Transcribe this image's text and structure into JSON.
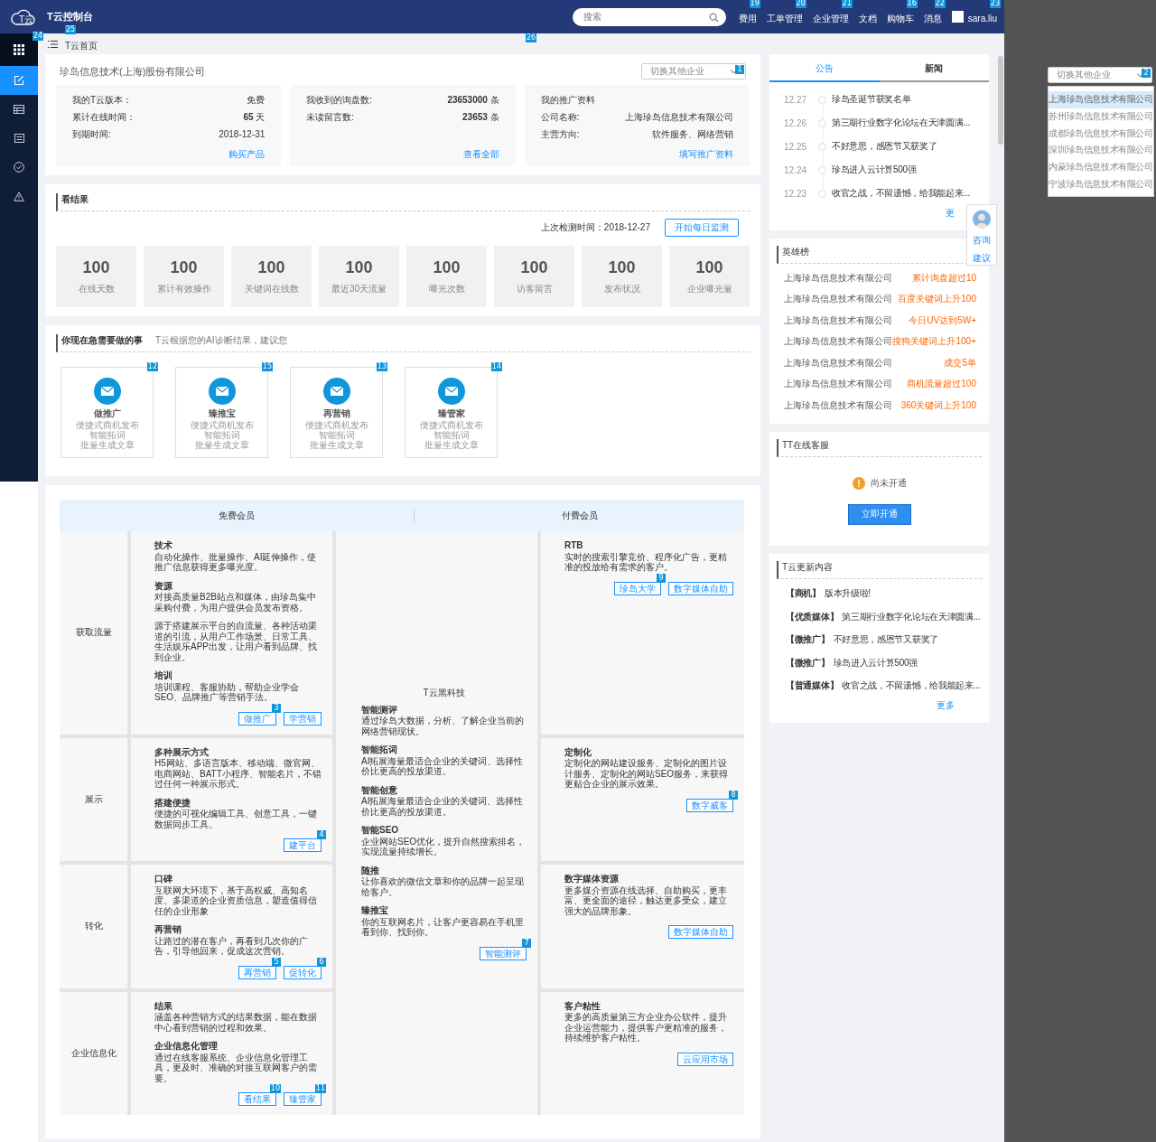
{
  "header": {
    "logo_text": "T云",
    "title": "T云控制台",
    "search": {
      "placeholder": "搜索"
    },
    "nav": [
      {
        "label": "费用",
        "badge": "19"
      },
      {
        "label": "工单管理",
        "badge": "20"
      },
      {
        "label": "企业管理",
        "badge": "21"
      },
      {
        "label": "文档"
      },
      {
        "label": "购物车",
        "badge": "16"
      },
      {
        "label": "消息",
        "badge": "22"
      }
    ],
    "user": {
      "name": "sara.liu",
      "badge": "23"
    }
  },
  "sidebar": {
    "badge": "24",
    "items": [
      {
        "kind": "grid",
        "selected": false
      },
      {
        "kind": "edit",
        "selected": true
      },
      {
        "kind": "table",
        "selected": false
      },
      {
        "kind": "list",
        "selected": false
      },
      {
        "kind": "check",
        "selected": false
      },
      {
        "kind": "warning",
        "selected": false
      }
    ]
  },
  "breadcrumb": {
    "label": "T云首页",
    "badge": "25",
    "bar_badge": "26"
  },
  "company_card": {
    "name": "珍岛信息技术(上海)股份有限公司",
    "switcher": {
      "label": "切换其他企业",
      "badge": "1"
    },
    "boxes": [
      {
        "rows": [
          {
            "label": "我的T云版本：",
            "value": "免费"
          },
          {
            "label": "累计在线时间：",
            "value": "65",
            "unit": "天"
          },
          {
            "label": "到期时间:",
            "value": "2018-12-31"
          }
        ],
        "link": "购买产品"
      },
      {
        "rows": [
          {
            "label": "我收到的询盘数:",
            "value": "23653000",
            "unit": "条"
          },
          {
            "label": "未读留言数:",
            "value": "23653",
            "unit": "条"
          }
        ],
        "link": "查看全部"
      },
      {
        "heading": "我的推广资料",
        "rows": [
          {
            "label": "公司名称:",
            "value": "上海珍岛信息技术有限公司"
          },
          {
            "label": "主营方向:",
            "value": "软件服务、网络营销"
          }
        ],
        "link": "填写推广资料"
      }
    ]
  },
  "results": {
    "title": "看结果",
    "last_check": "上次检测时间：2018-12-27",
    "button": "开始每日监测",
    "stats": [
      {
        "value": "100",
        "label": "在线天数"
      },
      {
        "value": "100",
        "label": "累计有效操作"
      },
      {
        "value": "100",
        "label": "关键词在线数"
      },
      {
        "value": "100",
        "label": "最近30天流量"
      },
      {
        "value": "100",
        "label": "曝光次数"
      },
      {
        "value": "100",
        "label": "访客留言"
      },
      {
        "value": "100",
        "label": "发布状况"
      },
      {
        "value": "100",
        "label": "企业曝光量"
      }
    ]
  },
  "todo": {
    "title": "你现在急需要做的事",
    "subtitle": "T云根据您的AI诊断结果，建议您",
    "cards": [
      {
        "title": "做推广",
        "lines": [
          "便捷式商机发布",
          "智能拓词",
          "批量生成文章"
        ],
        "badge": "12"
      },
      {
        "title": "臻推宝",
        "lines": [
          "便捷式商机发布",
          "智能拓词",
          "批量生成文章"
        ],
        "badge": "15"
      },
      {
        "title": "再营销",
        "lines": [
          "便捷式商机发布",
          "智能拓词",
          "批量生成文章"
        ],
        "badge": "13"
      },
      {
        "title": "臻管家",
        "lines": [
          "便捷式商机发布",
          "智能拓词",
          "批量生成文章"
        ],
        "badge": "14"
      }
    ]
  },
  "membership": {
    "free_header": "免费会员",
    "paid_header": "付费会员",
    "rows": [
      {
        "category": "获取流量",
        "free": {
          "blocks": [
            {
              "title": "技术",
              "text": "自动化操作、批量操作、AI延伸操作，使推广信息获得更多曝光度。"
            },
            {
              "title": "资源",
              "text": "对接高质量B2B站点和媒体，由珍岛集中采购付费，为用户提供会员发布资格。"
            },
            {
              "text": "源于搭建展示平台的自流量、各种活动渠道的引流，从用户工作场景、日常工具、生活娱乐APP出发，让用户看到品牌、找到企业。"
            },
            {
              "title": "培训",
              "text": "培训课程、客服协助，帮助企业学会SEO、品牌推广等营销手法。"
            }
          ],
          "buttons": [
            {
              "label": "做推广",
              "badge": "3"
            },
            {
              "label": "学营销"
            }
          ]
        },
        "paid": {
          "blocks": [
            {
              "title": "RTB",
              "text": "实时的搜索引擎竞价、程序化广告，更精准的投放给有需求的客户。"
            }
          ],
          "buttons": [
            {
              "label": "珍岛大学",
              "badge": "9"
            },
            {
              "label": "数字媒体自助"
            }
          ]
        }
      },
      {
        "category": "展示",
        "free": {
          "blocks": [
            {
              "title": "多种展示方式",
              "text": "H5网站、多语言版本、移动端、微官网、电商网站、BATT小程序、智能名片，不错过任何一种展示形式。"
            },
            {
              "title": "搭建便捷",
              "text": "便捷的可视化编辑工具、创意工具，一键数据同步工具。"
            }
          ],
          "buttons": [
            {
              "label": "建平台",
              "badge": "4"
            }
          ]
        },
        "paid": {
          "blocks": [
            {
              "title": "定制化",
              "text": "定制化的网站建设服务、定制化的图片设计服务、定制化的网站SEO服务，来获得更贴合企业的展示效果。"
            }
          ],
          "buttons": [
            {
              "label": "数字威客",
              "badge": "8"
            }
          ]
        }
      },
      {
        "category": "转化",
        "free": {
          "blocks": [
            {
              "title": "口碑",
              "text": "互联网大环境下，基于高权威、高知名度、多渠道的企业资质信息，塑造值得信任的企业形象"
            },
            {
              "title": "再营销",
              "text": "让路过的潜在客户，再看到几次你的广告，引导他回来，促成这次营销。"
            }
          ],
          "buttons": [
            {
              "label": "再营销",
              "badge": "5"
            },
            {
              "label": "促转化",
              "badge": "6"
            }
          ]
        },
        "paid": {
          "blocks": [
            {
              "title": "数字媒体资源",
              "text": "更多媒介资源在线选择、自助购买，更丰富、更全面的途径，触达更多受众，建立强大的品牌形象。"
            }
          ],
          "buttons": [
            {
              "label": "数字媒体自助"
            }
          ]
        }
      },
      {
        "category": "企业信息化",
        "free": {
          "blocks": [
            {
              "title": "结果",
              "text": "涵盖各种营销方式的结果数据，能在数据中心看到营销的过程和效果。"
            },
            {
              "title": "企业信息化管理",
              "text": "通过在线客服系统、企业信息化管理工具，更及时、准确的对接互联网客户的需要。"
            }
          ],
          "buttons": [
            {
              "label": "看结果",
              "badge": "10"
            },
            {
              "label": "臻管家",
              "badge": "11"
            }
          ]
        },
        "paid": {
          "blocks": [
            {
              "title": "客户粘性",
              "text": "更多的高质量第三方企业办公软件，提升企业运营能力，提供客户更精准的服务，持续维护客户粘性。"
            }
          ],
          "buttons": [
            {
              "label": "云应用市场"
            }
          ]
        }
      }
    ],
    "middle": {
      "title": "T云黑科技",
      "blocks": [
        {
          "title": "智能测评",
          "text": "通过珍岛大数据，分析、了解企业当前的网络营销现状。"
        },
        {
          "title": "智能拓词",
          "text": "AI拓展海量最适合企业的关键词、选择性价比更高的投放渠道。"
        },
        {
          "title": "智能创意",
          "text": "AI拓展海量最适合企业的关键词、选择性价比更高的投放渠道。"
        },
        {
          "title": "智能SEO",
          "text": "企业网站SEO优化，提升自然搜索排名，实现流量持续增长。"
        },
        {
          "title": "随推",
          "text": "让你喜欢的微信文章和你的品牌一起呈现给客户。"
        },
        {
          "title": "臻推宝",
          "text": "你的互联网名片，让客户更容易在手机里看到你、找到你。"
        }
      ],
      "buttons": [
        {
          "label": "智能测评",
          "badge": "7"
        }
      ]
    }
  },
  "news": {
    "tabs": [
      {
        "label": "公告",
        "selected": true
      },
      {
        "label": "新闻",
        "selected": false
      }
    ],
    "items": [
      {
        "date": "12.27",
        "text": "珍岛圣诞节获奖名单"
      },
      {
        "date": "12.26",
        "text": "第三期行业数字化论坛在天津圆满..."
      },
      {
        "date": "12.25",
        "text": "不好意思，感恩节又获奖了"
      },
      {
        "date": "12.24",
        "text": "珍岛进入云计算500强"
      },
      {
        "date": "12.23",
        "text": "收官之战，不留遗憾，给我能起来..."
      }
    ],
    "more": "更"
  },
  "float_widget": {
    "links": [
      "咨询",
      "建议"
    ]
  },
  "heroes": {
    "title": "英雄榜",
    "items": [
      {
        "company": "上海珍岛信息技术有限公司",
        "achievement": "累计询盘超过10"
      },
      {
        "company": "上海珍岛信息技术有限公司",
        "achievement": "百度关键词上升100"
      },
      {
        "company": "上海珍岛信息技术有限公司",
        "achievement": "今日UV达到5W+"
      },
      {
        "company": "上海珍岛信息技术有限公司",
        "achievement": "搜狗关键词上升100+"
      },
      {
        "company": "上海珍岛信息技术有限公司",
        "achievement": "成交5单"
      },
      {
        "company": "上海珍岛信息技术有限公司",
        "achievement": "商机流量超过100"
      },
      {
        "company": "上海珍岛信息技术有限公司",
        "achievement": "360关键词上升100"
      }
    ]
  },
  "service": {
    "title": "TT在线客服",
    "status": "尚未开通",
    "button": "立即开通"
  },
  "updates": {
    "title": "T云更新内容",
    "items": [
      {
        "tag": "【商机】",
        "text": "版本升级啦!"
      },
      {
        "tag": "【优质媒体】",
        "text": "第三期行业数字化论坛在天津圆满..."
      },
      {
        "tag": "【微推广】",
        "text": "不好意思，感恩节又获奖了"
      },
      {
        "tag": "【微推广】",
        "text": "珍岛进入云计算500强"
      },
      {
        "tag": "【普通媒体】",
        "text": "收官之战，不留遗憾，给我能起来..."
      }
    ],
    "more": "更多"
  },
  "dropdown_demo": {
    "label": "切换其他企业",
    "badge": "2",
    "options": [
      {
        "label": "上海珍岛信息技术有限公司",
        "selected": true
      },
      {
        "label": "苏州珍岛信息技术有限公司",
        "selected": false
      },
      {
        "label": "成都珍岛信息技术有限公司",
        "selected": false
      },
      {
        "label": "深圳珍岛信息技术有限公司",
        "selected": false
      },
      {
        "label": "内蒙珍岛信息技术有限公司",
        "selected": false
      },
      {
        "label": "宁波珍岛信息技术有限公司",
        "selected": false
      }
    ]
  }
}
